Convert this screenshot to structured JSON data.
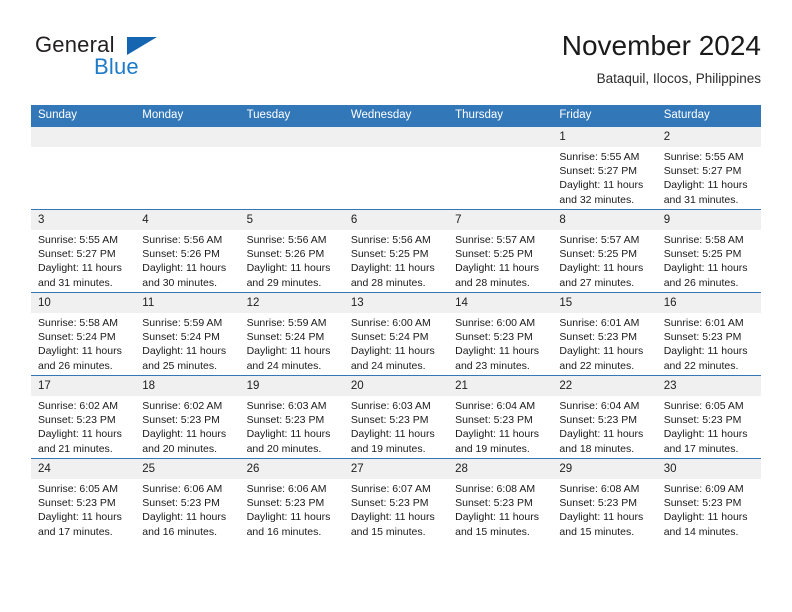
{
  "brand": {
    "name_part1": "General",
    "name_part2": "Blue",
    "triangle_color": "#1565b0",
    "blue_color": "#1e7bc8"
  },
  "header": {
    "title": "November 2024",
    "subtitle": "Bataquil, Ilocos, Philippines"
  },
  "theme": {
    "header_bg": "#3277b8",
    "daynum_bg": "#f0f0f0",
    "row_border": "#3277b8"
  },
  "calendar": {
    "weekday_headers": [
      "Sunday",
      "Monday",
      "Tuesday",
      "Wednesday",
      "Thursday",
      "Friday",
      "Saturday"
    ],
    "weeks": [
      [
        {
          "day": "",
          "empty": true
        },
        {
          "day": "",
          "empty": true
        },
        {
          "day": "",
          "empty": true
        },
        {
          "day": "",
          "empty": true
        },
        {
          "day": "",
          "empty": true
        },
        {
          "day": "1",
          "sunrise": "Sunrise: 5:55 AM",
          "sunset": "Sunset: 5:27 PM",
          "daylight": "Daylight: 11 hours and 32 minutes."
        },
        {
          "day": "2",
          "sunrise": "Sunrise: 5:55 AM",
          "sunset": "Sunset: 5:27 PM",
          "daylight": "Daylight: 11 hours and 31 minutes."
        }
      ],
      [
        {
          "day": "3",
          "sunrise": "Sunrise: 5:55 AM",
          "sunset": "Sunset: 5:27 PM",
          "daylight": "Daylight: 11 hours and 31 minutes."
        },
        {
          "day": "4",
          "sunrise": "Sunrise: 5:56 AM",
          "sunset": "Sunset: 5:26 PM",
          "daylight": "Daylight: 11 hours and 30 minutes."
        },
        {
          "day": "5",
          "sunrise": "Sunrise: 5:56 AM",
          "sunset": "Sunset: 5:26 PM",
          "daylight": "Daylight: 11 hours and 29 minutes."
        },
        {
          "day": "6",
          "sunrise": "Sunrise: 5:56 AM",
          "sunset": "Sunset: 5:25 PM",
          "daylight": "Daylight: 11 hours and 28 minutes."
        },
        {
          "day": "7",
          "sunrise": "Sunrise: 5:57 AM",
          "sunset": "Sunset: 5:25 PM",
          "daylight": "Daylight: 11 hours and 28 minutes."
        },
        {
          "day": "8",
          "sunrise": "Sunrise: 5:57 AM",
          "sunset": "Sunset: 5:25 PM",
          "daylight": "Daylight: 11 hours and 27 minutes."
        },
        {
          "day": "9",
          "sunrise": "Sunrise: 5:58 AM",
          "sunset": "Sunset: 5:25 PM",
          "daylight": "Daylight: 11 hours and 26 minutes."
        }
      ],
      [
        {
          "day": "10",
          "sunrise": "Sunrise: 5:58 AM",
          "sunset": "Sunset: 5:24 PM",
          "daylight": "Daylight: 11 hours and 26 minutes."
        },
        {
          "day": "11",
          "sunrise": "Sunrise: 5:59 AM",
          "sunset": "Sunset: 5:24 PM",
          "daylight": "Daylight: 11 hours and 25 minutes."
        },
        {
          "day": "12",
          "sunrise": "Sunrise: 5:59 AM",
          "sunset": "Sunset: 5:24 PM",
          "daylight": "Daylight: 11 hours and 24 minutes."
        },
        {
          "day": "13",
          "sunrise": "Sunrise: 6:00 AM",
          "sunset": "Sunset: 5:24 PM",
          "daylight": "Daylight: 11 hours and 24 minutes."
        },
        {
          "day": "14",
          "sunrise": "Sunrise: 6:00 AM",
          "sunset": "Sunset: 5:23 PM",
          "daylight": "Daylight: 11 hours and 23 minutes."
        },
        {
          "day": "15",
          "sunrise": "Sunrise: 6:01 AM",
          "sunset": "Sunset: 5:23 PM",
          "daylight": "Daylight: 11 hours and 22 minutes."
        },
        {
          "day": "16",
          "sunrise": "Sunrise: 6:01 AM",
          "sunset": "Sunset: 5:23 PM",
          "daylight": "Daylight: 11 hours and 22 minutes."
        }
      ],
      [
        {
          "day": "17",
          "sunrise": "Sunrise: 6:02 AM",
          "sunset": "Sunset: 5:23 PM",
          "daylight": "Daylight: 11 hours and 21 minutes."
        },
        {
          "day": "18",
          "sunrise": "Sunrise: 6:02 AM",
          "sunset": "Sunset: 5:23 PM",
          "daylight": "Daylight: 11 hours and 20 minutes."
        },
        {
          "day": "19",
          "sunrise": "Sunrise: 6:03 AM",
          "sunset": "Sunset: 5:23 PM",
          "daylight": "Daylight: 11 hours and 20 minutes."
        },
        {
          "day": "20",
          "sunrise": "Sunrise: 6:03 AM",
          "sunset": "Sunset: 5:23 PM",
          "daylight": "Daylight: 11 hours and 19 minutes."
        },
        {
          "day": "21",
          "sunrise": "Sunrise: 6:04 AM",
          "sunset": "Sunset: 5:23 PM",
          "daylight": "Daylight: 11 hours and 19 minutes."
        },
        {
          "day": "22",
          "sunrise": "Sunrise: 6:04 AM",
          "sunset": "Sunset: 5:23 PM",
          "daylight": "Daylight: 11 hours and 18 minutes."
        },
        {
          "day": "23",
          "sunrise": "Sunrise: 6:05 AM",
          "sunset": "Sunset: 5:23 PM",
          "daylight": "Daylight: 11 hours and 17 minutes."
        }
      ],
      [
        {
          "day": "24",
          "sunrise": "Sunrise: 6:05 AM",
          "sunset": "Sunset: 5:23 PM",
          "daylight": "Daylight: 11 hours and 17 minutes."
        },
        {
          "day": "25",
          "sunrise": "Sunrise: 6:06 AM",
          "sunset": "Sunset: 5:23 PM",
          "daylight": "Daylight: 11 hours and 16 minutes."
        },
        {
          "day": "26",
          "sunrise": "Sunrise: 6:06 AM",
          "sunset": "Sunset: 5:23 PM",
          "daylight": "Daylight: 11 hours and 16 minutes."
        },
        {
          "day": "27",
          "sunrise": "Sunrise: 6:07 AM",
          "sunset": "Sunset: 5:23 PM",
          "daylight": "Daylight: 11 hours and 15 minutes."
        },
        {
          "day": "28",
          "sunrise": "Sunrise: 6:08 AM",
          "sunset": "Sunset: 5:23 PM",
          "daylight": "Daylight: 11 hours and 15 minutes."
        },
        {
          "day": "29",
          "sunrise": "Sunrise: 6:08 AM",
          "sunset": "Sunset: 5:23 PM",
          "daylight": "Daylight: 11 hours and 15 minutes."
        },
        {
          "day": "30",
          "sunrise": "Sunrise: 6:09 AM",
          "sunset": "Sunset: 5:23 PM",
          "daylight": "Daylight: 11 hours and 14 minutes."
        }
      ]
    ]
  }
}
